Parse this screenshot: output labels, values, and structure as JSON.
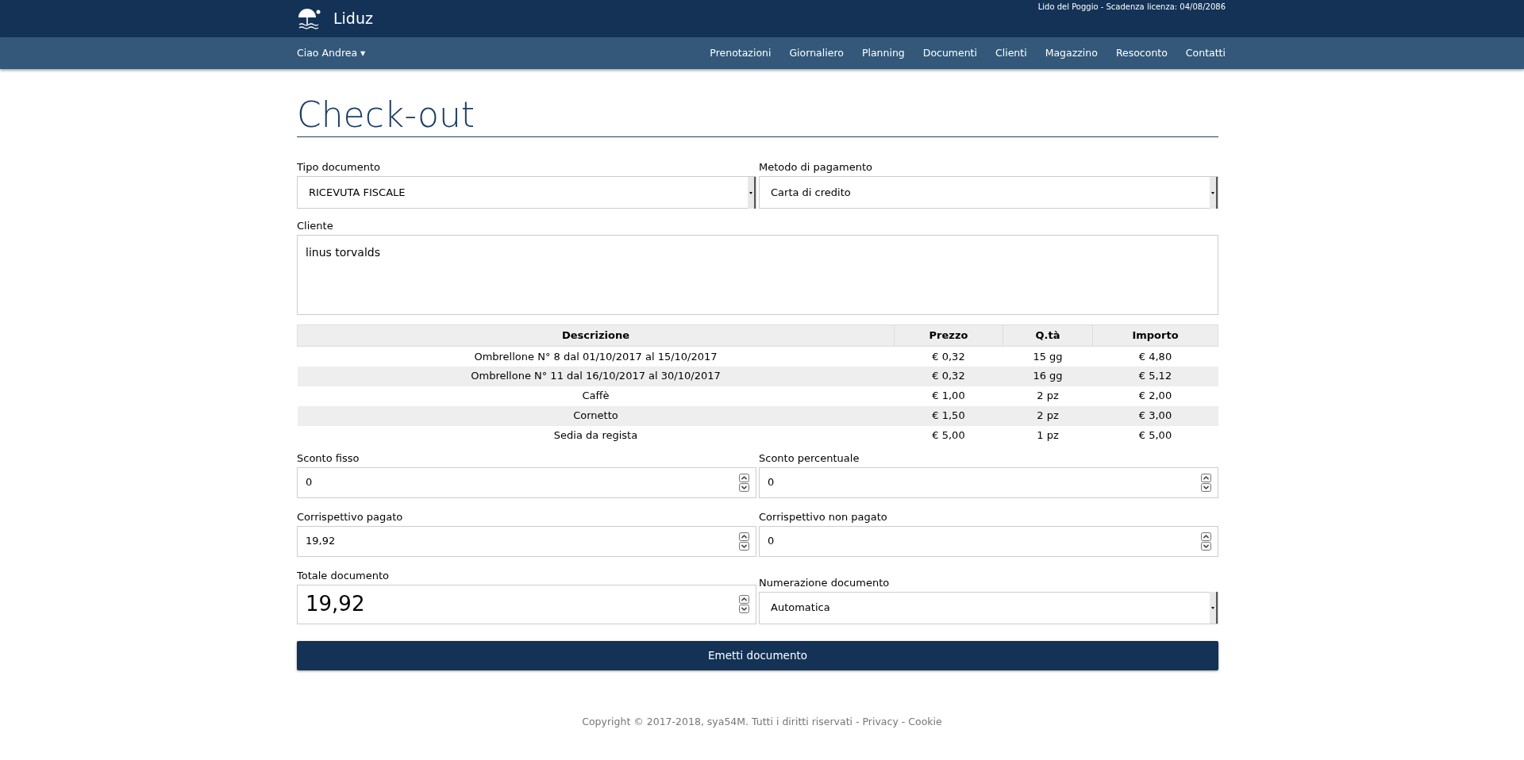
{
  "header": {
    "brand": "Liduz",
    "license": "Lido del Poggio - Scadenza licenza: 04/08/2086"
  },
  "navbar": {
    "user_menu": "Ciao Andrea ▾",
    "items": [
      "Prenotazioni",
      "Giornaliero",
      "Planning",
      "Documenti",
      "Clienti",
      "Magazzino",
      "Resoconto",
      "Contatti"
    ]
  },
  "page_title": "Check-out",
  "top_fields": [
    {
      "label": "Tipo documento",
      "kind": "select",
      "value": "RICEVUTA FISCALE"
    },
    {
      "label": "Metodo di pagamento",
      "kind": "select",
      "value": "Carta di credito"
    }
  ],
  "cliente": {
    "label": "Cliente",
    "value": "linus torvalds"
  },
  "table": {
    "columns": [
      "Descrizione",
      "Prezzo",
      "Q.tà",
      "Importo"
    ],
    "rows": [
      [
        "Ombrellone N° 8 dal 01/10/2017 al 15/10/2017",
        "€ 0,32",
        "15 gg",
        "€ 4,80"
      ],
      [
        "Ombrellone N° 11 dal 16/10/2017 al 30/10/2017",
        "€ 0,32",
        "16 gg",
        "€ 5,12"
      ],
      [
        "Caffè",
        "€ 1,00",
        "2 pz",
        "€ 2,00"
      ],
      [
        "Cornetto",
        "€ 1,50",
        "2 pz",
        "€ 3,00"
      ],
      [
        "Sedia da regista",
        "€ 5,00",
        "1 pz",
        "€ 5,00"
      ]
    ]
  },
  "bottom_fields": [
    {
      "label": "Sconto fisso",
      "kind": "number",
      "value": "0"
    },
    {
      "label": "Sconto percentuale",
      "kind": "number",
      "value": "0"
    },
    {
      "label": "Corrispettivo pagato",
      "kind": "number",
      "value": "19,92"
    },
    {
      "label": "Corrispettivo non pagato",
      "kind": "number",
      "value": "0"
    },
    {
      "label": "Totale documento",
      "kind": "total",
      "value": "19,92"
    },
    {
      "label": "Numerazione documento",
      "kind": "select",
      "value": "Automatica"
    }
  ],
  "submit_button": "Emetti documento",
  "footer": {
    "text": "Copyright © 2017-2018, sya54M. Tutti i diritti riservati -",
    "links": [
      "Privacy",
      "Cookie"
    ],
    "separator": "-"
  }
}
